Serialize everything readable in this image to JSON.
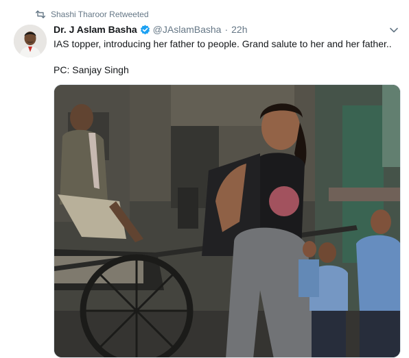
{
  "social_context": {
    "text": "Shashi Tharoor Retweeted",
    "icon": "retweet-icon"
  },
  "tweet": {
    "author_name": "Dr. J Aslam Basha",
    "handle": "@JAslamBasha",
    "separator": "·",
    "time": "22h",
    "verified": true,
    "text_line1": "IAS topper, introducing her father to people. Grand salute to her and her father..",
    "text_line2": "PC: Sanjay Singh",
    "menu_icon": "chevron-down-icon"
  },
  "media": {
    "type": "photo"
  },
  "colors": {
    "secondary_text": "#657786",
    "verified_blue": "#1da1f2",
    "primary_text": "#14171a"
  }
}
